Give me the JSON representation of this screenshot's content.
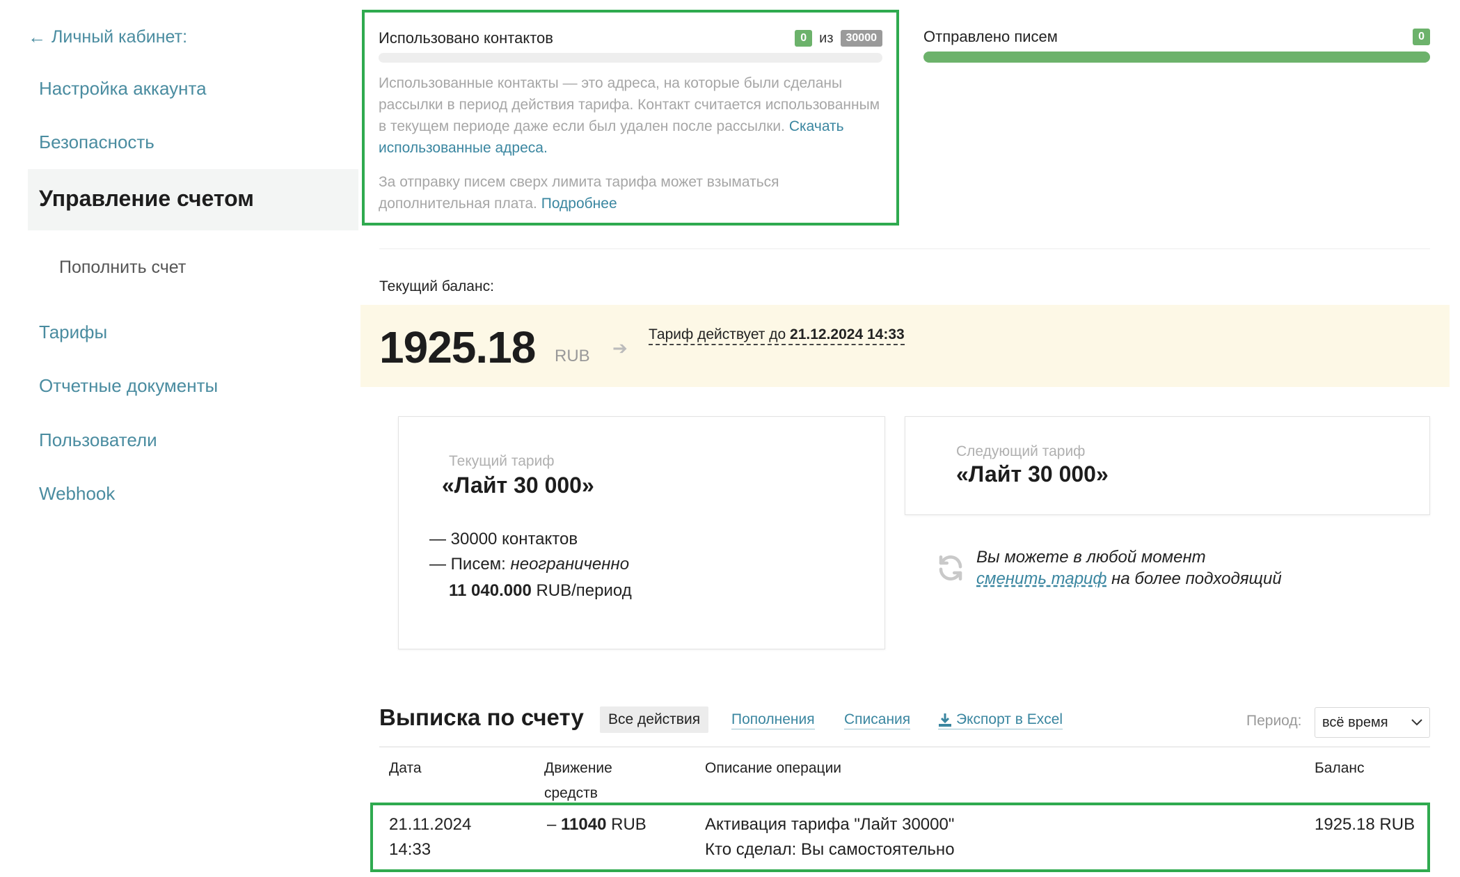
{
  "sidebar": {
    "back_label": "Личный кабинет:",
    "items": {
      "account": "Настройка аккаунта",
      "security": "Безопасность",
      "billing": "Управление счетом",
      "topup": "Пополнить счет",
      "tariffs": "Тарифы",
      "reports": "Отчетные документы",
      "users": "Пользователи",
      "webhook": "Webhook"
    }
  },
  "usage": {
    "contacts_title": "Использовано контактов",
    "contacts_used": "0",
    "of_label": "из",
    "contacts_limit": "30000",
    "contacts_fill": 0,
    "description": "Использованные контакты — это адреса, на которые были сделаны рассылки в период действия тарифа. Контакт считается использованным в текущем периоде даже если был удален после рассылки.",
    "download_link": "Скачать использованные адреса.",
    "overlimit_text": "За отправку писем сверх лимита тарифа может взыматься дополнительная плата.",
    "more_link": "Подробнее",
    "sent_title": "Отправлено писем",
    "sent_count": "0",
    "sent_fill": 1
  },
  "balance": {
    "label": "Текущий баланс:",
    "amount": "1925.18",
    "currency": "RUB",
    "valid_prefix": "Тариф действует до",
    "valid_until": "21.12.2024 14:33"
  },
  "current_tariff": {
    "label": "Текущий тариф",
    "name": "«Лайт 30 000»",
    "feature_contacts": "— 30000 контактов",
    "feature_letters_prefix": "— Писем:",
    "feature_letters_value": "неограниченно",
    "price_value": "11 040.000",
    "price_unit": "RUB/период"
  },
  "next_tariff": {
    "label": "Следующий тариф",
    "name": "«Лайт 30 000»"
  },
  "change_note": {
    "line1": "Вы можете в любой момент",
    "link": "сменить тариф",
    "line2_suffix": "на более подходящий"
  },
  "statement": {
    "title": "Выписка по счету",
    "filters": {
      "all": "Все действия",
      "deposits": "Пополнения",
      "charges": "Списания",
      "export": "Экспорт в Excel"
    },
    "period_label": "Период:",
    "period_value": "всё время",
    "columns": {
      "date": "Дата",
      "movement_line1": "Движение",
      "movement_line2": "средств",
      "description": "Описание операции",
      "balance": "Баланс"
    },
    "row": {
      "date": "21.11.2024",
      "time": "14:33",
      "sign": "–",
      "amount": "11040",
      "currency": "RUB",
      "description": "Активация тарифа \"Лайт 30000\"",
      "actor": "Кто сделал: Вы самостоятельно",
      "balance": "1925.18 RUB"
    }
  },
  "colors": {
    "accent_link": "#3a86a0",
    "highlight_border": "#2faa4f",
    "progress_green": "#6cb26b",
    "balance_band": "#fdf8e6"
  }
}
